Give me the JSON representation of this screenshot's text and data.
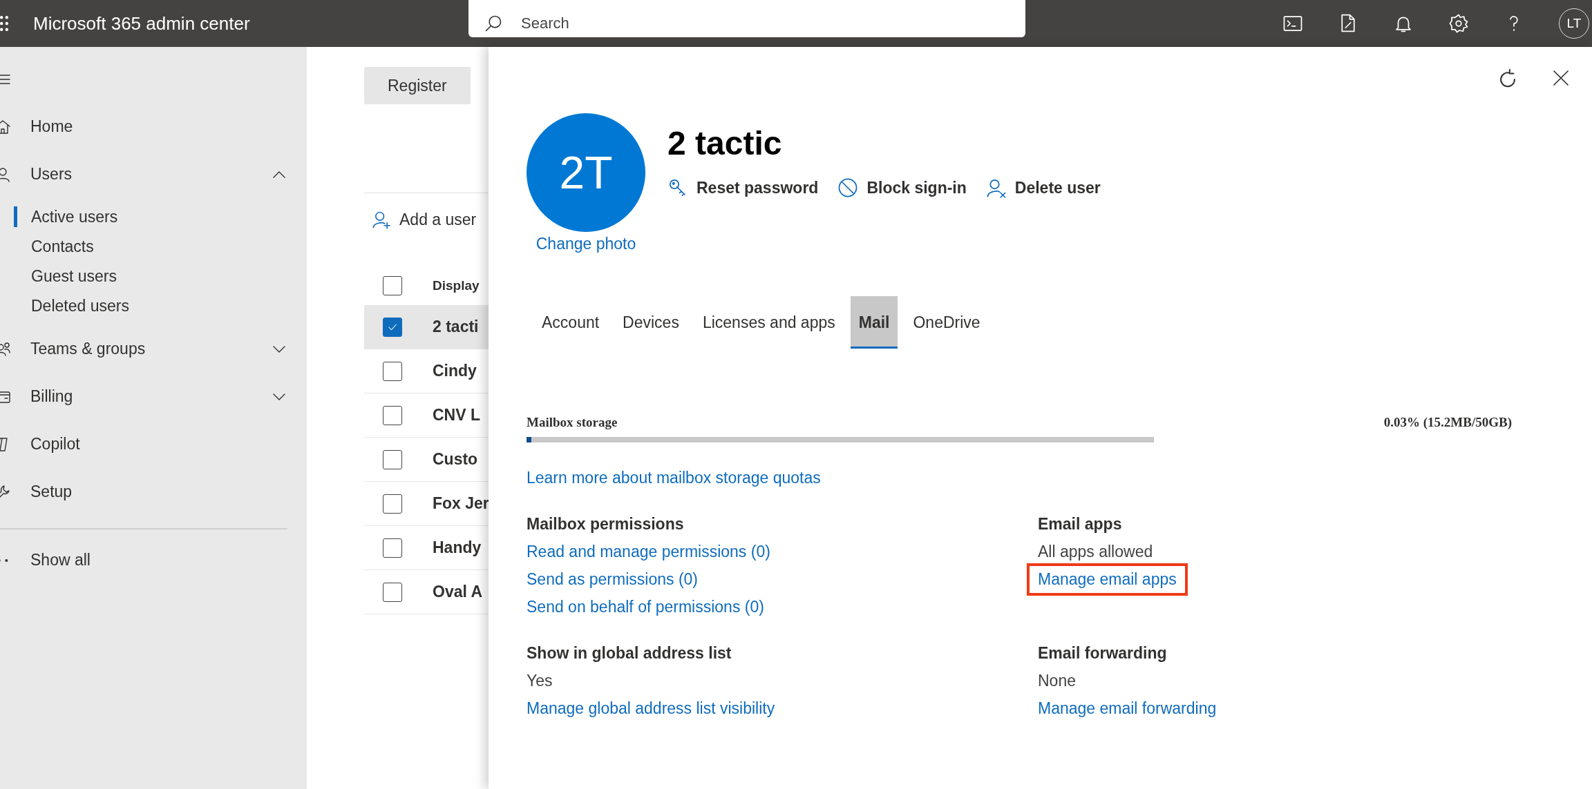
{
  "top_bar": {
    "title": "Microsoft 365 admin center",
    "search": {
      "placeholder": "Search"
    },
    "avatar": "LT"
  },
  "sidebar": {
    "items": [
      {
        "kind": "link",
        "label": "Home"
      },
      {
        "kind": "group",
        "label": "Users",
        "expanded": true,
        "children": [
          {
            "label": "Active users",
            "selected": true
          },
          {
            "label": "Contacts",
            "selected": false
          },
          {
            "label": "Guest users",
            "selected": false
          },
          {
            "label": "Deleted users",
            "selected": false
          }
        ]
      },
      {
        "kind": "group",
        "label": "Teams & groups",
        "expanded": false
      },
      {
        "kind": "group",
        "label": "Billing",
        "expanded": false
      },
      {
        "kind": "link",
        "label": "Copilot"
      },
      {
        "kind": "link",
        "label": "Setup"
      }
    ],
    "show_all": "Show all"
  },
  "main": {
    "register_button": "Register",
    "add_user": "Add a user",
    "user_list": {
      "header": "Display",
      "header_checked": false,
      "rows": [
        {
          "name": "2 tacti",
          "checked": true
        },
        {
          "name": "Cindy",
          "checked": false
        },
        {
          "name": "CNV L",
          "checked": false
        },
        {
          "name": "Custo",
          "checked": false
        },
        {
          "name": "Fox Jer",
          "checked": false
        },
        {
          "name": "Handy",
          "checked": false
        },
        {
          "name": "Oval A",
          "checked": false
        }
      ]
    }
  },
  "panel": {
    "initials": "2T",
    "change_photo": "Change photo",
    "name": "2 tactic",
    "actions": [
      {
        "label": "Reset password"
      },
      {
        "label": "Block sign-in"
      },
      {
        "label": "Delete user"
      }
    ],
    "tabs": [
      {
        "label": "Account",
        "selected": false
      },
      {
        "label": "Devices",
        "selected": false
      },
      {
        "label": "Licenses and apps",
        "selected": false
      },
      {
        "label": "Mail",
        "selected": true
      },
      {
        "label": "OneDrive",
        "selected": false
      }
    ],
    "storage": {
      "label": "Mailbox storage",
      "reading": "0.03% (15.2MB/50GB)",
      "level": 0.008
    },
    "learn_more": "Learn more about mailbox storage quotas",
    "sections": [
      {
        "heading": "Mailbox permissions",
        "links": [
          {
            "text": "Read and manage permissions (0)",
            "highlighted": false
          },
          {
            "text": "Send as permissions (0)",
            "highlighted": false
          },
          {
            "text": "Send on behalf of permissions (0)",
            "highlighted": false
          }
        ]
      },
      {
        "heading": "Email apps",
        "value": "All apps allowed",
        "links": [
          {
            "text": "Manage email apps",
            "highlighted": true
          }
        ]
      },
      {
        "heading": "Show in global address list",
        "value": "Yes",
        "links": [
          {
            "text": "Manage global address list visibility",
            "highlighted": false
          }
        ]
      },
      {
        "heading": "Email forwarding",
        "value": "None",
        "links": [
          {
            "text": "Manage email forwarding",
            "highlighted": false
          }
        ]
      }
    ]
  }
}
